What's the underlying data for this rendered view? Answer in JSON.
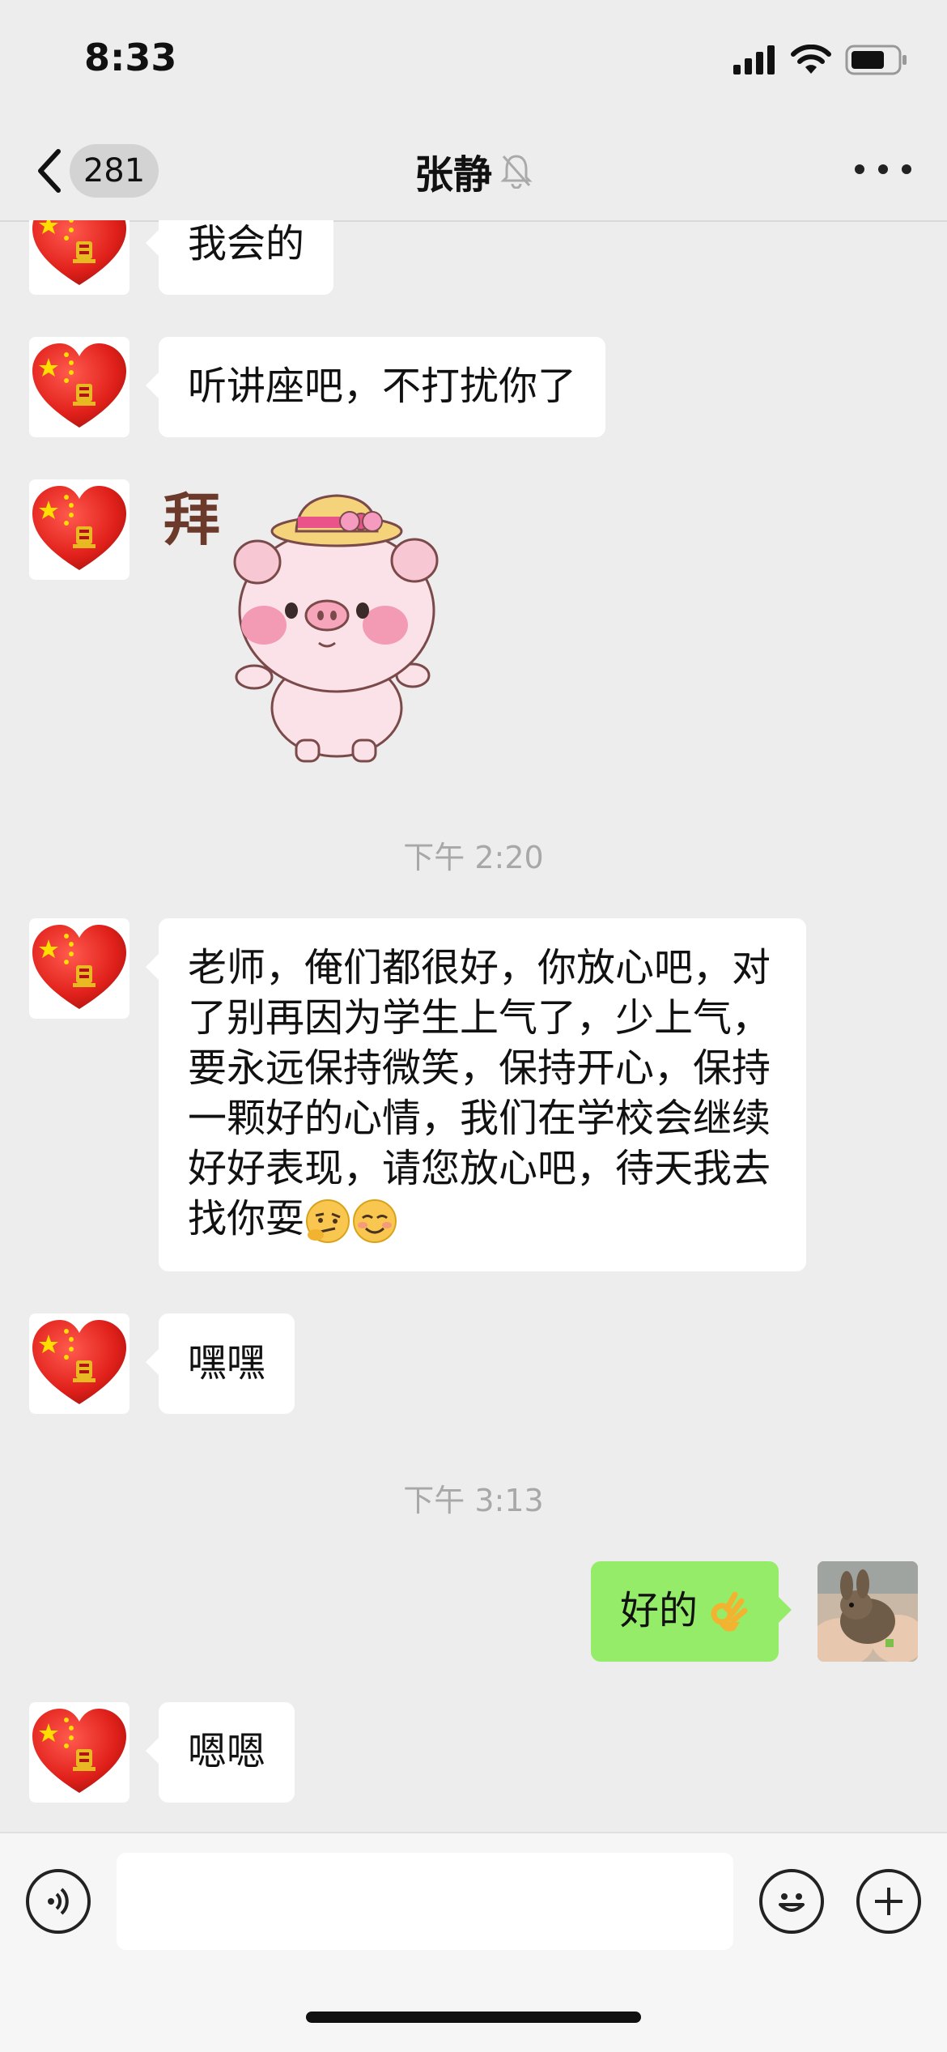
{
  "status_bar": {
    "time": "8:33"
  },
  "nav": {
    "unread_count": "281",
    "title": "张静"
  },
  "messages": [
    {
      "text": "我会的"
    },
    {
      "text": "听讲座吧，不打扰你了"
    },
    {
      "sticker_text": "拜"
    },
    {
      "time": "下午 2:20"
    },
    {
      "text": "老师，俺们都很好，你放心吧，对了别再因为学生上气了，少上气，要永远保持微笑，保持开心，保持一颗好的心情，我们在学校会继续好好表现，请您放心吧，待天我去找你耍"
    },
    {
      "text": "嘿嘿"
    },
    {
      "time": "下午 3:13"
    },
    {
      "text": "好的"
    },
    {
      "text": "嗯嗯"
    }
  ],
  "colors": {
    "background": "#ededed",
    "bubble_self": "#95ec69",
    "bubble_other": "#ffffff"
  },
  "icons": [
    "back-icon",
    "muted-bell-icon",
    "more-icon",
    "voice-icon",
    "emoji-icon",
    "plus-icon",
    "ok-hand-emoji",
    "thinking-emoji",
    "smile-emoji"
  ]
}
